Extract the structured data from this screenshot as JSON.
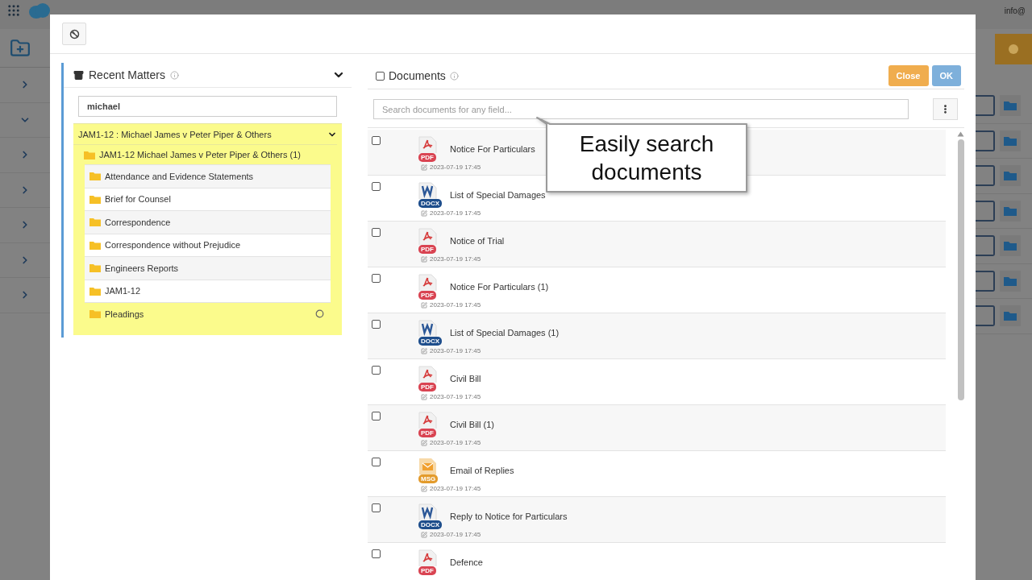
{
  "app": {
    "user": "info@"
  },
  "modal": {
    "recent_matters": {
      "title": "Recent Matters",
      "expanded": true,
      "search": {
        "value": "michael"
      },
      "matters": [
        {
          "label": "JAM1-12 : Michael James v Peter Piper & Others",
          "expanded": true,
          "children": [
            {
              "label": "JAM1-12 Michael James v Peter Piper & Others (1)",
              "children": [
                {
                  "label": "Attendance and Evidence Statements",
                  "loading": false
                },
                {
                  "label": "Brief for Counsel",
                  "loading": false
                },
                {
                  "label": "Correspondence",
                  "loading": false
                },
                {
                  "label": "Correspondence without Prejudice",
                  "loading": false
                },
                {
                  "label": "Engineers Reports",
                  "loading": false
                },
                {
                  "label": "JAM1-12",
                  "loading": false
                },
                {
                  "label": "Pleadings",
                  "loading": true
                }
              ]
            }
          ]
        }
      ]
    },
    "documents": {
      "title": "Documents",
      "checked": false,
      "buttons": [
        {
          "kind": "close",
          "label": "Close"
        },
        {
          "kind": "ok",
          "label": "OK"
        }
      ],
      "search": {
        "placeholder": "Search documents for any field..."
      },
      "items": [
        {
          "name": "Notice For Particulars",
          "kind": "pdf",
          "badge": "PDF",
          "modified": "2023-07-19 17:45",
          "checked": false
        },
        {
          "name": "List of Special Damages",
          "kind": "docx",
          "badge": "DOCX",
          "modified": "2023-07-19 17:45",
          "checked": false
        },
        {
          "name": "Notice of Trial",
          "kind": "pdf",
          "badge": "PDF",
          "modified": "2023-07-19 17:45",
          "checked": false
        },
        {
          "name": "Notice For Particulars (1)",
          "kind": "pdf",
          "badge": "PDF",
          "modified": "2023-07-19 17:45",
          "checked": false
        },
        {
          "name": "List of Special Damages (1)",
          "kind": "docx",
          "badge": "DOCX",
          "modified": "2023-07-19 17:45",
          "checked": false
        },
        {
          "name": "Civil Bill",
          "kind": "pdf",
          "badge": "PDF",
          "modified": "2023-07-19 17:45",
          "checked": false
        },
        {
          "name": "Civil Bill (1)",
          "kind": "pdf",
          "badge": "PDF",
          "modified": "2023-07-19 17:45",
          "checked": false
        },
        {
          "name": "Email of Replies",
          "kind": "msg",
          "badge": "MSG",
          "modified": "2023-07-19 17:45",
          "checked": false
        },
        {
          "name": "Reply to Notice for Particulars",
          "kind": "docx",
          "badge": "DOCX",
          "modified": "2023-07-19 17:45",
          "checked": false
        },
        {
          "name": "Defence",
          "kind": "pdf",
          "badge": "PDF",
          "checked": false
        }
      ]
    },
    "callout": "Easily search documents"
  }
}
